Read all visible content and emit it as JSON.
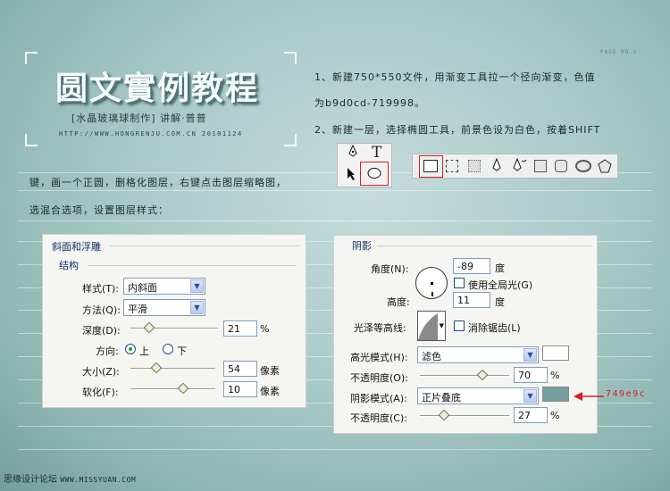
{
  "header": {
    "title": "圆文實例教程",
    "subtitle": "[水晶玻璃球制作] 讲解·普普",
    "url_date": "HTTP://WWW.HONGRENJU.COM.CN  20101124",
    "page_no": "PAGE NO.1"
  },
  "text": {
    "line1": "1、新建750*550文件，用渐变工具拉一个径向渐变，色值",
    "line2": "为b9d0cd-719998。",
    "line3": "2、新建一层，选择椭圆工具，前景色设为白色，按着SHIFT",
    "line4": "键，画一个正圆，删格化图层，右键点击图层缩略图，",
    "line5": "选混合选项，设置图层样式："
  },
  "toolbox": {
    "type_tool_glyph": "T"
  },
  "bevel_panel": {
    "title": "斜面和浮雕",
    "section": "结构",
    "style_label": "样式(T):",
    "style_value": "内斜面",
    "method_label": "方法(Q):",
    "method_value": "平滑",
    "depth_label": "深度(D):",
    "depth_value": "21",
    "depth_unit": "%",
    "depth_level": 0.21,
    "direction_label": "方向:",
    "dir_up": "上",
    "dir_down": "下",
    "size_label": "大小(Z):",
    "size_value": "54",
    "size_unit": "像素",
    "size_level": 0.3,
    "soften_label": "软化(F):",
    "soften_value": "10",
    "soften_unit": "像素",
    "soften_level": 0.62
  },
  "shadow_panel": {
    "title": "阴影",
    "angle_label": "角度(N):",
    "angle_value": "-89",
    "angle_unit": "度",
    "global_light_label": "使用全局光(G)",
    "altitude_label": "高度:",
    "altitude_value": "11",
    "altitude_unit": "度",
    "gloss_label": "光泽等高线:",
    "antialias_label": "消除锯齿(L)",
    "highlight_mode_label": "高光模式(H):",
    "highlight_mode_value": "滤色",
    "highlight_color": "#ffffff",
    "opacity1_label": "不透明度(O):",
    "opacity1_value": "70",
    "opacity1_unit": "%",
    "opacity1_level": 0.7,
    "shadow_mode_label": "阴影模式(A):",
    "shadow_mode_value": "正片叠底",
    "shadow_color": "#749e9c",
    "opacity2_label": "不透明度(C):",
    "opacity2_value": "27",
    "opacity2_unit": "%",
    "opacity2_level": 0.27
  },
  "annotation": {
    "color_code": "749e9c",
    "arrow_color": "#d42020"
  },
  "watermark": {
    "text": "思缘设计论坛",
    "url": "WWW.MISSYUAN.COM"
  },
  "colors": {
    "bg_center": "#b9d0cd",
    "bg_edge": "#719998"
  }
}
